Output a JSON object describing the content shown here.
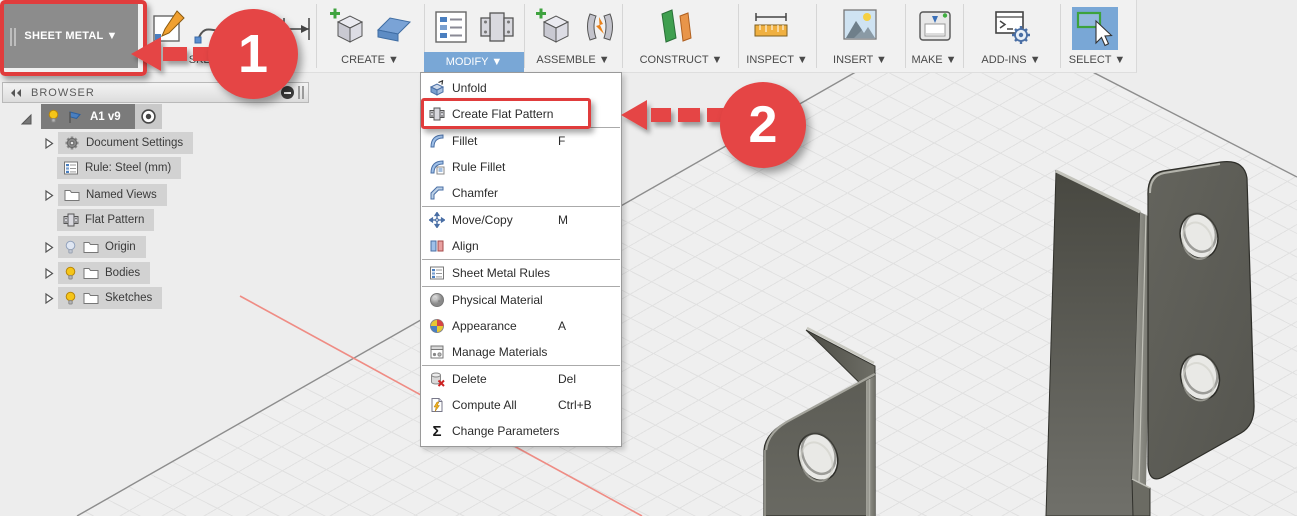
{
  "colors": {
    "accent_blue": "#79a7d6",
    "annotation_red": "#e54545",
    "toolbar_bg": "#f1f1f1",
    "viewport_bg": "#ededed",
    "chip_gray": "#d2d2d2",
    "root_chip_gray": "#7b7b7b",
    "red_axis": "#ef8c84"
  },
  "toolbar": {
    "environment_label": "SHEET METAL ▼",
    "groups": [
      {
        "label": "SKETCH ▼"
      },
      {
        "label": "CREATE ▼"
      },
      {
        "label": "MODIFY ▼"
      },
      {
        "label": "ASSEMBLE ▼"
      },
      {
        "label": "CONSTRUCT ▼"
      },
      {
        "label": "INSPECT ▼"
      },
      {
        "label": "INSERT ▼"
      },
      {
        "label": "MAKE ▼"
      },
      {
        "label": "ADD-INS ▼"
      },
      {
        "label": "SELECT ▼"
      }
    ]
  },
  "browser": {
    "title": "BROWSER",
    "root_label": "A1 v9",
    "items": [
      {
        "label": "Document Settings"
      },
      {
        "label": "Rule: Steel (mm)"
      },
      {
        "label": "Named Views"
      },
      {
        "label": "Flat Pattern"
      },
      {
        "label": "Origin"
      },
      {
        "label": "Bodies"
      },
      {
        "label": "Sketches"
      }
    ]
  },
  "modify_menu": {
    "sigma_icon": "Σ",
    "items": [
      {
        "label": "Unfold",
        "shortcut": ""
      },
      {
        "label": "Create Flat Pattern",
        "shortcut": ""
      },
      {
        "label": "Fillet",
        "shortcut": "F"
      },
      {
        "label": "Rule Fillet",
        "shortcut": ""
      },
      {
        "label": "Chamfer",
        "shortcut": ""
      },
      {
        "label": "Move/Copy",
        "shortcut": "M"
      },
      {
        "label": "Align",
        "shortcut": ""
      },
      {
        "label": "Sheet Metal Rules",
        "shortcut": ""
      },
      {
        "label": "Physical Material",
        "shortcut": ""
      },
      {
        "label": "Appearance",
        "shortcut": "A"
      },
      {
        "label": "Manage Materials",
        "shortcut": ""
      },
      {
        "label": "Delete",
        "shortcut": "Del"
      },
      {
        "label": "Compute All",
        "shortcut": "Ctrl+B"
      },
      {
        "label": "Change Parameters",
        "shortcut": ""
      }
    ]
  },
  "annotations": {
    "step1": "1",
    "step2": "2"
  }
}
